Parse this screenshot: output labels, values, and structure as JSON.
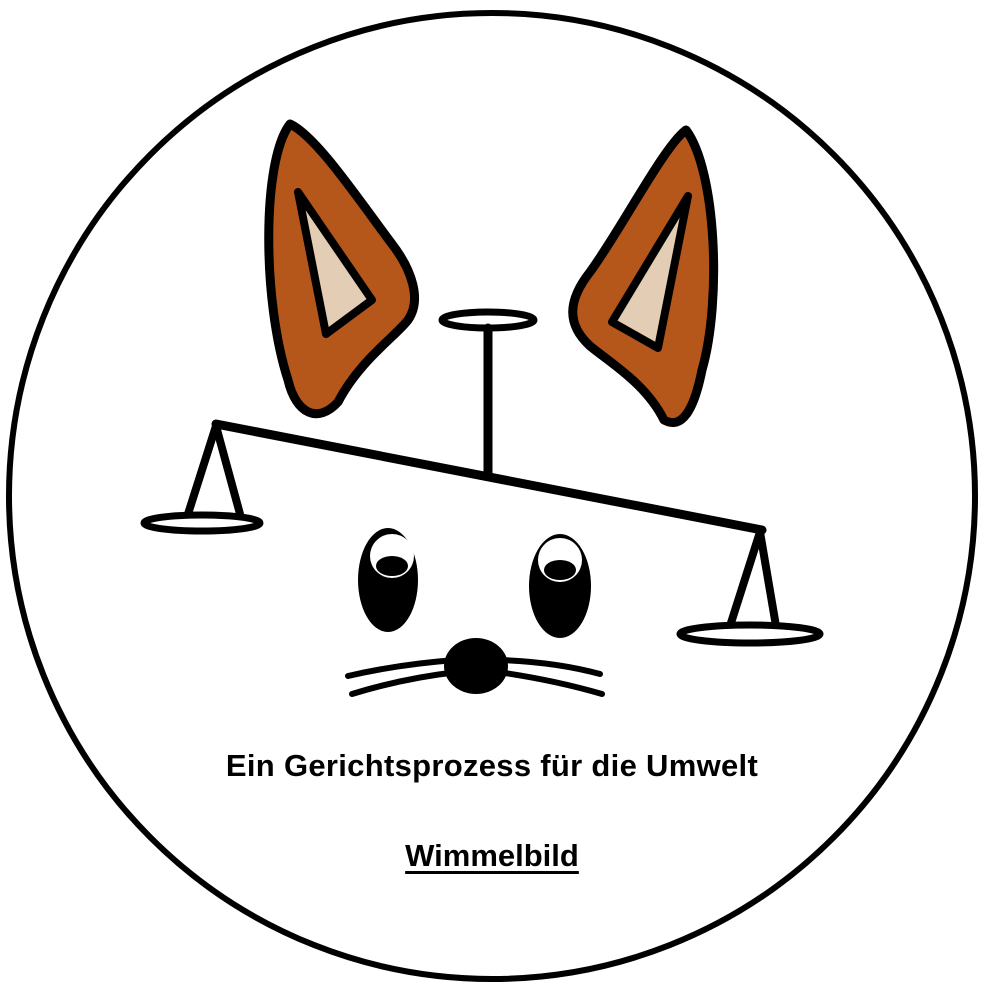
{
  "title": "Ein Gerichtsprozess für die Umwelt",
  "subtitle": "Wimmelbild",
  "icons": [
    "fox-ear-left-icon",
    "fox-ear-right-icon",
    "justice-scale-icon",
    "fox-eye-icon",
    "fox-nose-icon",
    "whiskers-icon"
  ],
  "colors": {
    "outline": "#000000",
    "ear_fur": "#b5561b",
    "ear_inner": "#e3cdb4",
    "background": "#ffffff"
  }
}
